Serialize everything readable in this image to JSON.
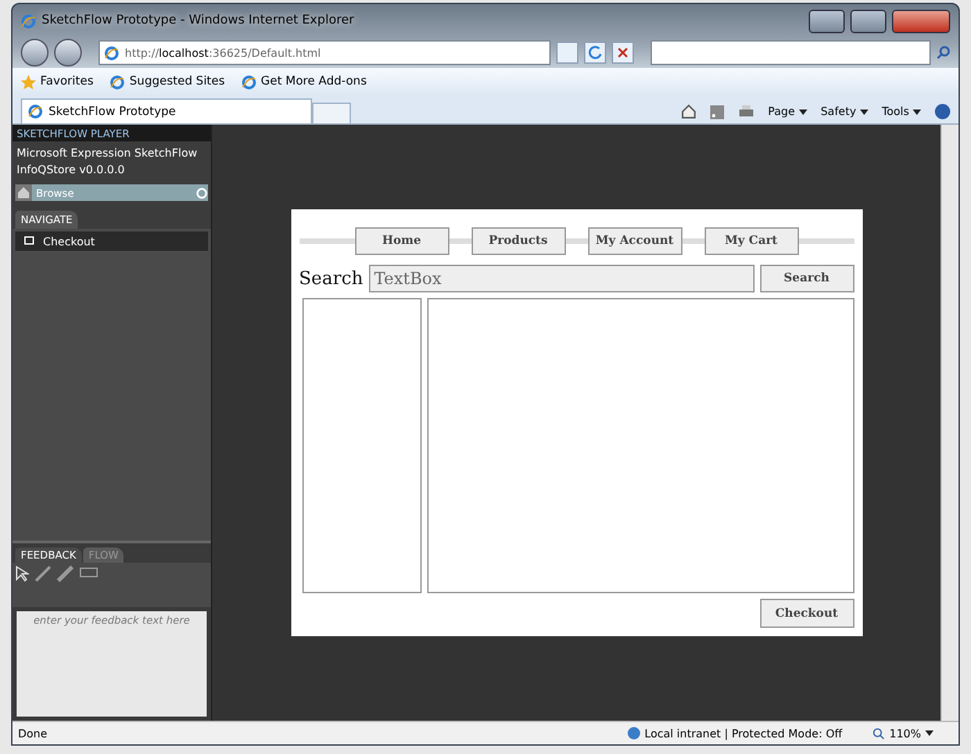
{
  "window": {
    "title": "SketchFlow Prototype - Windows Internet Explorer"
  },
  "address_bar": {
    "url": "http://**localhost**:36625/Default.html"
  },
  "favorites_bar": {
    "items": [
      "Favorites",
      "Suggested Sites",
      "Get More Add-ons"
    ]
  },
  "tabs": [
    {
      "label": "SketchFlow Prototype",
      "selected": true
    }
  ],
  "command_bar": {
    "menus": [
      "Page",
      "Safety",
      "Tools"
    ]
  },
  "player": {
    "header": "SKETCHFLOW PLAYER",
    "title": "Microsoft Expression SketchFlow",
    "project": "InfoQStore v0.0.0.0",
    "browse": "Browse",
    "navigate_tab": "NAVIGATE",
    "screens": [
      {
        "label": "Checkout"
      }
    ],
    "feedback_tabs": [
      {
        "label": "FEEDBACK",
        "selected": true
      },
      {
        "label": "FLOW",
        "selected": false
      }
    ],
    "feedback_placeholder": "enter your feedback text here"
  },
  "sketch": {
    "nav": [
      "Home",
      "Products",
      "My Account",
      "My Cart"
    ],
    "search_label": "Search",
    "textbox": "TextBox",
    "search_button": "Search",
    "checkout_button": "Checkout"
  },
  "status_bar": {
    "text": "Done",
    "zone": "Local intranet | Protected Mode: Off",
    "zoom": "110%"
  }
}
